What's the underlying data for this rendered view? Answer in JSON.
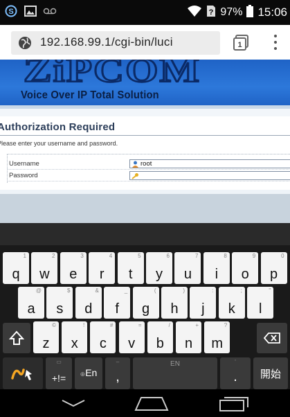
{
  "status_bar": {
    "battery_percent": "97%",
    "time": "15:06",
    "icons": [
      "skype-icon",
      "image-icon",
      "voicemail-icon",
      "wifi-icon",
      "no-sim-icon",
      "battery-icon"
    ]
  },
  "browser": {
    "url": "192.168.99.1/cgi-bin/luci",
    "tabs_count": "1"
  },
  "page": {
    "logo_text": "ZiPCOM",
    "tagline": "Voice Over IP Total Solution",
    "auth_title": "Authorization Required",
    "auth_desc": "Please enter your username and password.",
    "username_label": "Username",
    "username_value": "root",
    "password_label": "Password",
    "password_value": ""
  },
  "keyboard": {
    "row1": [
      {
        "key": "q",
        "sub": "1"
      },
      {
        "key": "w",
        "sub": "2"
      },
      {
        "key": "e",
        "sub": "3"
      },
      {
        "key": "r",
        "sub": "4"
      },
      {
        "key": "t",
        "sub": "5"
      },
      {
        "key": "y",
        "sub": "6"
      },
      {
        "key": "u",
        "sub": "7"
      },
      {
        "key": "i",
        "sub": "8"
      },
      {
        "key": "o",
        "sub": "9"
      },
      {
        "key": "p",
        "sub": "0"
      }
    ],
    "row2": [
      {
        "key": "a",
        "sub": "@"
      },
      {
        "key": "s",
        "sub": "$"
      },
      {
        "key": "d",
        "sub": "&"
      },
      {
        "key": "f",
        "sub": "_"
      },
      {
        "key": "g",
        "sub": "("
      },
      {
        "key": "h",
        "sub": ")"
      },
      {
        "key": "j",
        "sub": ":"
      },
      {
        "key": "k",
        "sub": ";"
      },
      {
        "key": "l",
        "sub": "\""
      }
    ],
    "row3": [
      {
        "key": "z",
        "sub": "©"
      },
      {
        "key": "x",
        "sub": "!"
      },
      {
        "key": "c",
        "sub": "#"
      },
      {
        "key": "v",
        "sub": "="
      },
      {
        "key": "b",
        "sub": "/"
      },
      {
        "key": "n",
        "sub": "+"
      },
      {
        "key": "m",
        "sub": "?"
      }
    ],
    "symbols_label": "+!=",
    "lang_label": "En",
    "comma": ",",
    "space_label": "EN",
    "period": ".",
    "enter_label": "開始"
  },
  "colors": {
    "banner": "#2d78da",
    "keyboard_bg": "#1a1a1a",
    "key_dark": "#3a3a3a",
    "key_light": "#f4f4f4"
  }
}
